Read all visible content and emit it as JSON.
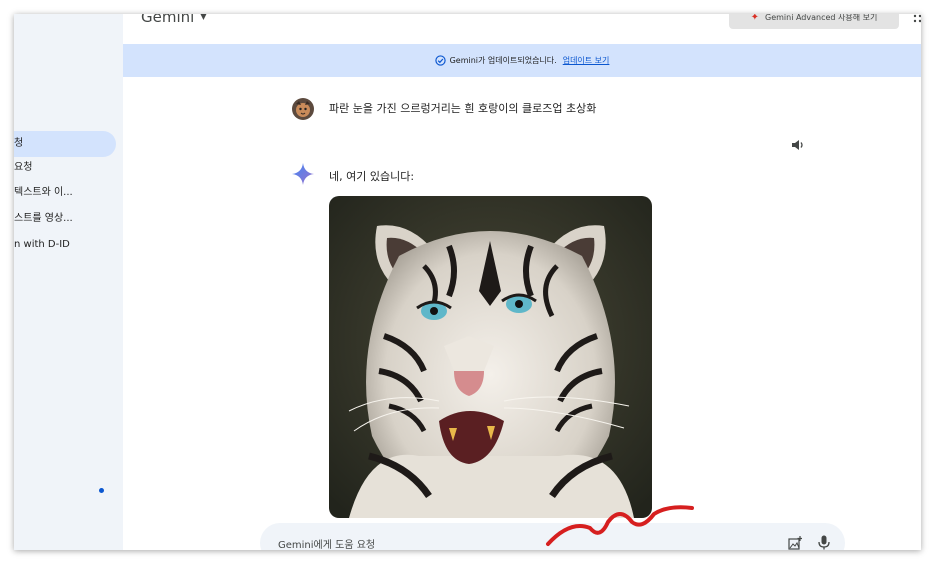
{
  "app": {
    "title": "Gemini"
  },
  "header": {
    "advanced_button_label": "Gemini Advanced 사용해 보기"
  },
  "banner": {
    "message": "Gemini가 업데이트되었습니다.",
    "link_label": "업데이트 보기"
  },
  "sidebar": {
    "items": [
      {
        "label": "청"
      },
      {
        "label": "요청"
      },
      {
        "label": "텍스트와 이..."
      },
      {
        "label": "스트를 영상..."
      },
      {
        "label": "n with D-ID"
      }
    ]
  },
  "conversation": {
    "user_prompt": "파란 눈을 가진 으르렁거리는 흰 호랑이의 클로즈업 초상화",
    "reply_text": "네, 여기 있습니다:",
    "image_alt": "white tiger portrait"
  },
  "input": {
    "placeholder": "Gemini에게 도움 요청"
  },
  "colors": {
    "accent": "#0b57d0",
    "banner_bg": "#d3e3fd",
    "sidebar_bg": "#f0f4f9",
    "annotation_red": "#d61f1f"
  },
  "icons": {
    "speaker": "speaker-icon",
    "sparkle": "gemini-sparkle-icon",
    "check": "check-circle-icon",
    "image_add": "image-add-icon",
    "mic": "mic-icon",
    "apps": "apps-grid-icon"
  }
}
